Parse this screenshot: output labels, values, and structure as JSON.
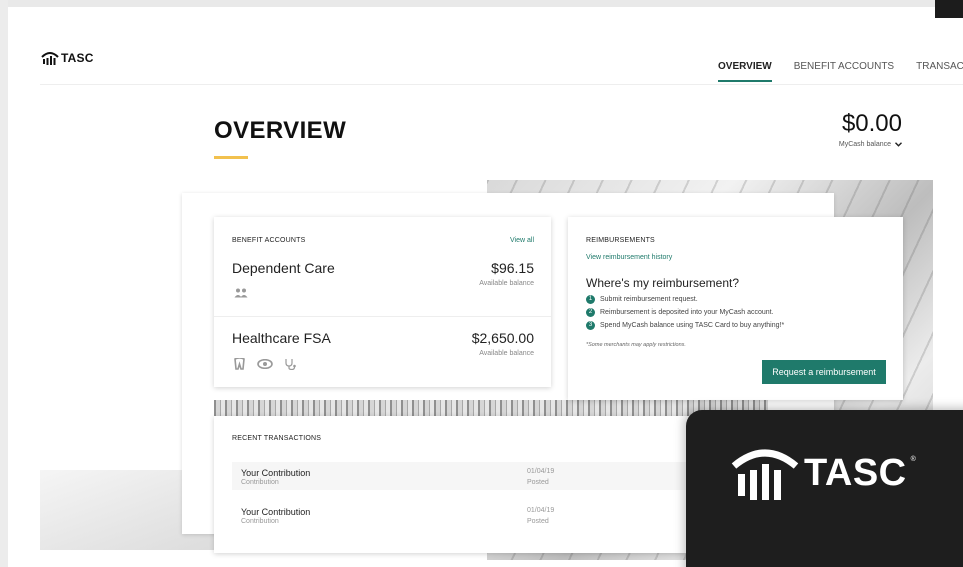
{
  "brand": {
    "name": "TASC",
    "logo_icon": "tasc-logo-icon"
  },
  "nav": {
    "items": [
      {
        "label": "OVERVIEW",
        "active": true
      },
      {
        "label": "BENEFIT ACCOUNTS",
        "active": false
      },
      {
        "label": "TRANSACT",
        "active": false
      }
    ]
  },
  "page": {
    "title": "OVERVIEW"
  },
  "mycash": {
    "amount": "$0.00",
    "label": "MyCash balance"
  },
  "benefit_accounts": {
    "heading": "BENEFIT ACCOUNTS",
    "view_all": "View all",
    "accounts": [
      {
        "name": "Dependent Care",
        "amount": "$96.15",
        "sub": "Available balance",
        "icons": [
          "people-icon"
        ]
      },
      {
        "name": "Healthcare FSA",
        "amount": "$2,650.00",
        "sub": "Available balance",
        "icons": [
          "tooth-icon",
          "eye-icon",
          "stethoscope-icon"
        ]
      }
    ]
  },
  "reimbursements": {
    "heading": "REIMBURSEMENTS",
    "history_link": "View reimbursement history",
    "question": "Where's my reimbursement?",
    "steps": [
      {
        "num": "1",
        "text": "Submit reimbursement request."
      },
      {
        "num": "2",
        "text": "Reimbursement is deposited into your MyCash account."
      },
      {
        "num": "3",
        "text": "Spend MyCash balance using TASC Card to buy anything!*"
      }
    ],
    "disclaimer": "*Some merchants may apply restrictions.",
    "button": "Request a reimbursement"
  },
  "transactions": {
    "heading": "RECENT TRANSACTIONS",
    "rows": [
      {
        "name": "Your Contribution",
        "type": "Contribution",
        "date": "01/04/19",
        "status": "Posted"
      },
      {
        "name": "Your Contribution",
        "type": "Contribution",
        "date": "01/04/19",
        "status": "Posted"
      }
    ]
  },
  "overlay": {
    "brand": "TASC",
    "reg": "®"
  },
  "colors": {
    "accent": "#1f7a6b",
    "underline": "#f2c14e",
    "overlay_bg": "#1e1e1e"
  }
}
